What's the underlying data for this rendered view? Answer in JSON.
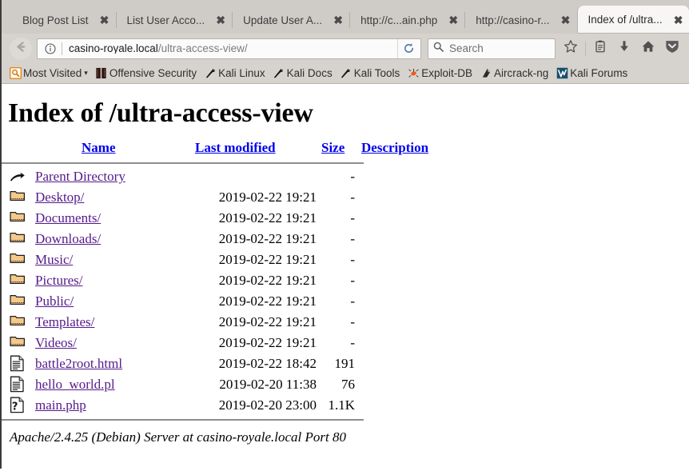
{
  "browser": {
    "tabs": [
      {
        "label": "Blog Post List",
        "active": false
      },
      {
        "label": "List User Acco...",
        "active": false
      },
      {
        "label": "Update User A...",
        "active": false
      },
      {
        "label": "http://c...ain.php",
        "active": false
      },
      {
        "label": "http://casino-r...",
        "active": false
      },
      {
        "label": "Index of /ultra...",
        "active": true
      }
    ],
    "tab_close_glyph": "✖",
    "nav": {
      "back_icon": "back-arrow-icon",
      "identity_icon": "info-circle-icon",
      "url_host": "casino-royale.local",
      "url_path": "/ultra-access-view/",
      "reload_icon": "reload-icon",
      "search_placeholder": "Search",
      "search_value": "",
      "bookmark_star_icon": "star-icon",
      "library_icon": "library-icon",
      "downloads_icon": "download-arrow-icon",
      "home_icon": "home-icon",
      "menu_icon": "chevron-down-shield-icon"
    },
    "bookmarks": [
      {
        "label": "Most Visited",
        "icon": "most-visited-icon",
        "caret": "▾"
      },
      {
        "label": "Offensive Security",
        "icon": "offensive-security-icon",
        "caret": ""
      },
      {
        "label": "Kali Linux",
        "icon": "kali-dragon-icon",
        "caret": ""
      },
      {
        "label": "Kali Docs",
        "icon": "kali-dragon-icon",
        "caret": ""
      },
      {
        "label": "Kali Tools",
        "icon": "kali-dragon-icon",
        "caret": ""
      },
      {
        "label": "Exploit-DB",
        "icon": "exploit-db-icon",
        "caret": ""
      },
      {
        "label": "Aircrack-ng",
        "icon": "aircrack-ng-icon",
        "caret": ""
      },
      {
        "label": "Kali Forums",
        "icon": "kali-forums-icon",
        "caret": ""
      }
    ]
  },
  "page": {
    "title": "Index of /ultra-access-view",
    "headers": {
      "name": "Name",
      "last_modified": "Last modified",
      "size": "Size",
      "description": "Description"
    },
    "rows": [
      {
        "icon": "parent-directory-icon",
        "name": "Parent Directory",
        "date": "",
        "size": "-",
        "desc": ""
      },
      {
        "icon": "folder-icon",
        "name": "Desktop/",
        "date": "2019-02-22 19:21",
        "size": "-",
        "desc": ""
      },
      {
        "icon": "folder-icon",
        "name": "Documents/",
        "date": "2019-02-22 19:21",
        "size": "-",
        "desc": ""
      },
      {
        "icon": "folder-icon",
        "name": "Downloads/",
        "date": "2019-02-22 19:21",
        "size": "-",
        "desc": ""
      },
      {
        "icon": "folder-icon",
        "name": "Music/",
        "date": "2019-02-22 19:21",
        "size": "-",
        "desc": ""
      },
      {
        "icon": "folder-icon",
        "name": "Pictures/",
        "date": "2019-02-22 19:21",
        "size": "-",
        "desc": ""
      },
      {
        "icon": "folder-icon",
        "name": "Public/",
        "date": "2019-02-22 19:21",
        "size": "-",
        "desc": ""
      },
      {
        "icon": "folder-icon",
        "name": "Templates/",
        "date": "2019-02-22 19:21",
        "size": "-",
        "desc": ""
      },
      {
        "icon": "folder-icon",
        "name": "Videos/",
        "date": "2019-02-22 19:21",
        "size": "-",
        "desc": ""
      },
      {
        "icon": "text-file-icon",
        "name": "battle2root.html",
        "date": "2019-02-22 18:42",
        "size": "191",
        "desc": ""
      },
      {
        "icon": "text-file-icon",
        "name": "hello_world.pl",
        "date": "2019-02-20 11:38",
        "size": "76",
        "desc": ""
      },
      {
        "icon": "unknown-file-icon",
        "name": "main.php",
        "date": "2019-02-20 23:00",
        "size": "1.1K",
        "desc": ""
      }
    ],
    "server_signature": "Apache/2.4.25 (Debian) Server at casino-royale.local Port 80"
  },
  "colors": {
    "link_unvisited": "#0000ee",
    "link_visited": "#551a8b",
    "chrome_bg": "#d6d2ce",
    "tab_active_bg": "#f7f6f5",
    "page_bg": "#ffffff",
    "folder_icon": "#f5c98a"
  }
}
